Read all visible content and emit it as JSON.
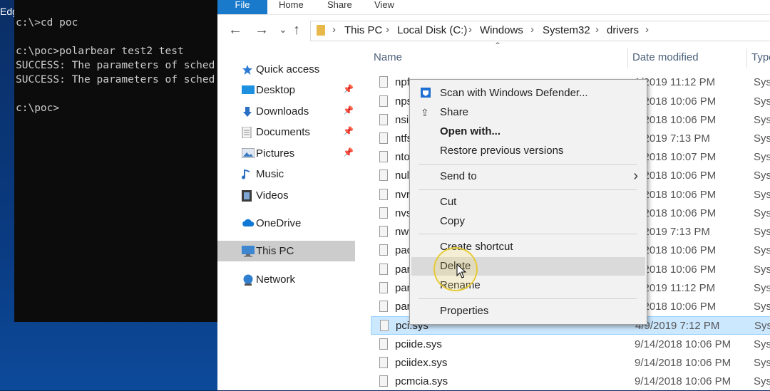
{
  "desktop": {
    "edge_label": "Edg"
  },
  "terminal": {
    "lines": [
      "c:\\>cd poc",
      "",
      "c:\\poc>polarbear test2 test",
      "SUCCESS: The parameters of sched",
      "SUCCESS: The parameters of sched",
      "",
      "c:\\poc>"
    ]
  },
  "ribbon": {
    "tabs": [
      "File",
      "Home",
      "Share",
      "View"
    ]
  },
  "nav_buttons": {
    "back": "←",
    "forward": "→",
    "recent": "⌄",
    "up": "↑"
  },
  "breadcrumb": [
    "This PC",
    "Local Disk (C:)",
    "Windows",
    "System32",
    "drivers"
  ],
  "nav_pane": {
    "items": [
      {
        "label": "Quick access",
        "icon": "star-icon",
        "pinned": false
      },
      {
        "label": "Desktop",
        "icon": "desktop-folder-icon",
        "pinned": true
      },
      {
        "label": "Downloads",
        "icon": "download-icon",
        "pinned": true
      },
      {
        "label": "Documents",
        "icon": "documents-icon",
        "pinned": true
      },
      {
        "label": "Pictures",
        "icon": "pictures-icon",
        "pinned": true
      },
      {
        "label": "Music",
        "icon": "music-icon",
        "pinned": false
      },
      {
        "label": "Videos",
        "icon": "videos-icon",
        "pinned": false
      },
      {
        "label": "OneDrive",
        "icon": "cloud-icon",
        "pinned": false
      },
      {
        "label": "This PC",
        "icon": "computer-icon",
        "pinned": false,
        "selected": true
      },
      {
        "label": "Network",
        "icon": "network-icon",
        "pinned": false
      }
    ]
  },
  "columns": {
    "name": "Name",
    "date": "Date modified",
    "type": "Type"
  },
  "files": [
    {
      "name": "npfs",
      "date": "1/2019 11:12 PM",
      "type": "Syst"
    },
    {
      "name": "nps",
      "date": "4/2018 10:06 PM",
      "type": "Syst"
    },
    {
      "name": "nsip",
      "date": "4/2018 10:06 PM",
      "type": "Syst"
    },
    {
      "name": "ntfs",
      "date": "9/2019 7:13 PM",
      "type": "Syst"
    },
    {
      "name": "ntos",
      "date": "4/2018 10:07 PM",
      "type": "Syst"
    },
    {
      "name": "null.",
      "date": "4/2018 10:06 PM",
      "type": "Syst"
    },
    {
      "name": "nvra",
      "date": "4/2018 10:06 PM",
      "type": "Syst"
    },
    {
      "name": "nvst",
      "date": "4/2018 10:06 PM",
      "type": "Syst"
    },
    {
      "name": "nwi",
      "date": "9/2019 7:13 PM",
      "type": "Syst"
    },
    {
      "name": "pac",
      "date": "4/2018 10:06 PM",
      "type": "Syst"
    },
    {
      "name": "parp",
      "date": "4/2018 10:06 PM",
      "type": "Syst"
    },
    {
      "name": "part",
      "date": "1/2019 11:12 PM",
      "type": "Syst"
    },
    {
      "name": "parv",
      "date": "4/2018 10:06 PM",
      "type": "Syst"
    },
    {
      "name": "pci.sys",
      "date": "4/9/2019 7:12 PM",
      "type": "Syst",
      "selected": true
    },
    {
      "name": "pciide.sys",
      "date": "9/14/2018 10:06 PM",
      "type": "Syst"
    },
    {
      "name": "pciidex.sys",
      "date": "9/14/2018 10:06 PM",
      "type": "Syst"
    },
    {
      "name": "pcmcia.sys",
      "date": "9/14/2018 10:06 PM",
      "type": "Syst"
    }
  ],
  "context_menu": {
    "scan": "Scan with Windows Defender...",
    "share": "Share",
    "open_with": "Open with...",
    "restore": "Restore previous versions",
    "send_to": "Send to",
    "cut": "Cut",
    "copy": "Copy",
    "create_shortcut": "Create shortcut",
    "delete": "Delete",
    "rename": "Rename",
    "properties": "Properties"
  }
}
